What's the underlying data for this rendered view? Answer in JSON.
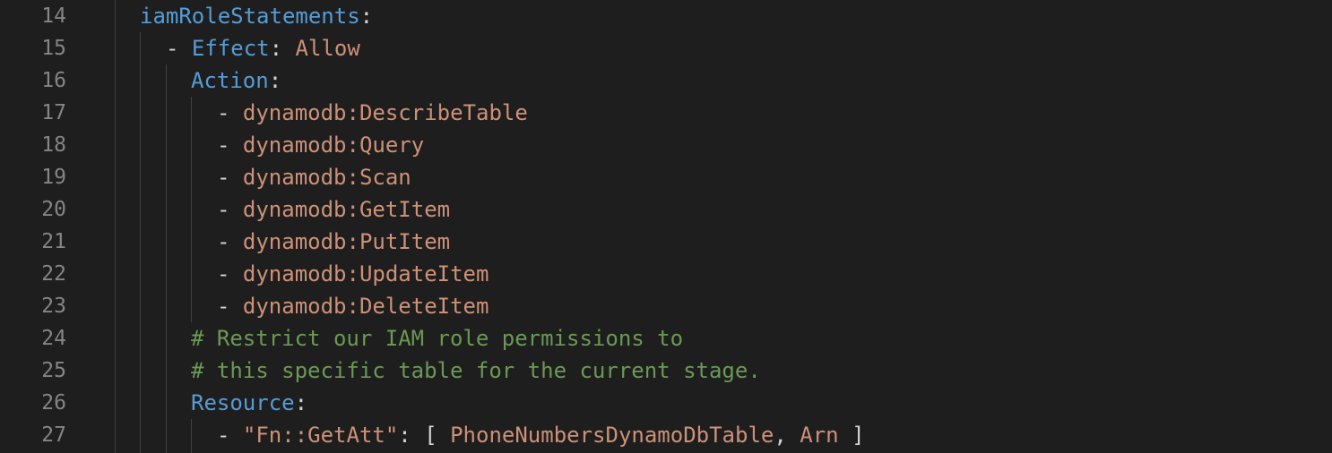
{
  "editor": {
    "lines": [
      {
        "number": "14",
        "key": "iamRoleStatements",
        "colon": ":"
      },
      {
        "number": "15",
        "dash": "-",
        "key": "Effect",
        "colon": ":",
        "value": "Allow"
      },
      {
        "number": "16",
        "key": "Action",
        "colon": ":"
      },
      {
        "number": "17",
        "dash": "-",
        "value": "dynamodb:DescribeTable"
      },
      {
        "number": "18",
        "dash": "-",
        "value": "dynamodb:Query"
      },
      {
        "number": "19",
        "dash": "-",
        "value": "dynamodb:Scan"
      },
      {
        "number": "20",
        "dash": "-",
        "value": "dynamodb:GetItem"
      },
      {
        "number": "21",
        "dash": "-",
        "value": "dynamodb:PutItem"
      },
      {
        "number": "22",
        "dash": "-",
        "value": "dynamodb:UpdateItem"
      },
      {
        "number": "23",
        "dash": "-",
        "value": "dynamodb:DeleteItem"
      },
      {
        "number": "24",
        "comment": "# Restrict our IAM role permissions to"
      },
      {
        "number": "25",
        "comment": "# this specific table for the current stage."
      },
      {
        "number": "26",
        "key": "Resource",
        "colon": ":"
      },
      {
        "number": "27",
        "dash": "-",
        "fn_key": "\"Fn::GetAtt\"",
        "colon": ":",
        "open_bracket": "[",
        "arg1": "PhoneNumbersDynamoDbTable",
        "comma": ",",
        "arg2": "Arn",
        "close_bracket": "]"
      }
    ]
  },
  "colors": {
    "background": "#1e1e1e",
    "line_number": "#858585",
    "key": "#569cd6",
    "string": "#ce9178",
    "comment": "#6a9955",
    "punctuation": "#d4d4d4",
    "indent_guide": "#404040"
  }
}
